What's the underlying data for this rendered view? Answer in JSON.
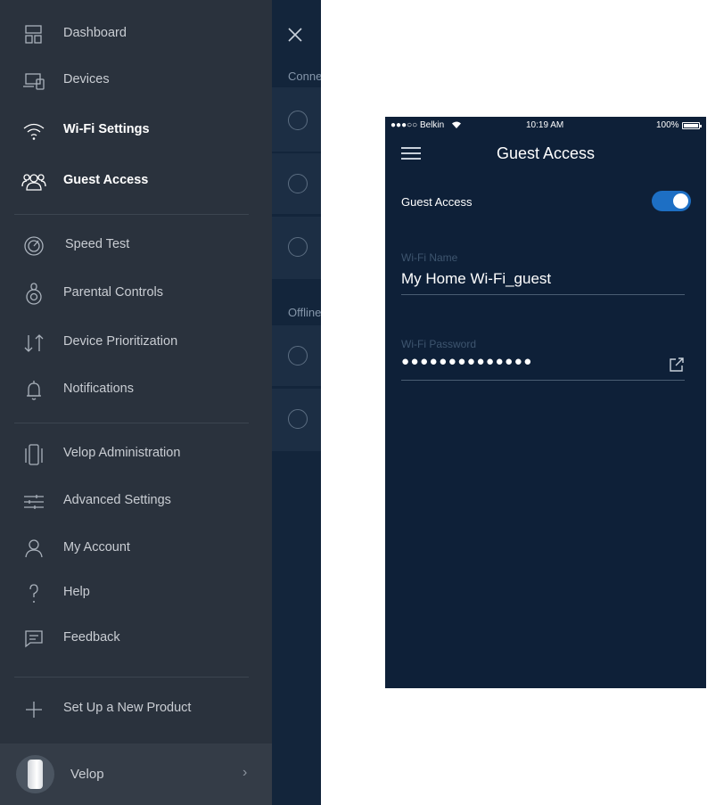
{
  "drawer": {
    "items": [
      {
        "label": "Dashboard",
        "icon": "dashboard-icon"
      },
      {
        "label": "Devices",
        "icon": "devices-icon"
      },
      {
        "label": "Wi-Fi Settings",
        "icon": "wifi-icon"
      },
      {
        "label": "Guest Access",
        "icon": "guest-access-icon"
      },
      {
        "label": "Speed Test",
        "icon": "speed-test-icon"
      },
      {
        "label": "Parental Controls",
        "icon": "parental-controls-icon"
      },
      {
        "label": "Device Prioritization",
        "icon": "device-prioritization-icon"
      },
      {
        "label": "Notifications",
        "icon": "bell-icon"
      },
      {
        "label": "Velop Administration",
        "icon": "velop-admin-icon"
      },
      {
        "label": "Advanced Settings",
        "icon": "sliders-icon"
      },
      {
        "label": "My Account",
        "icon": "account-icon"
      },
      {
        "label": "Help",
        "icon": "help-icon"
      },
      {
        "label": "Feedback",
        "icon": "feedback-icon"
      },
      {
        "label": "Set Up a New Product",
        "icon": "plus-icon"
      }
    ],
    "footer": {
      "label": "Velop"
    }
  },
  "background": {
    "connected_label": "Conne",
    "offline_label": "Offline"
  },
  "phone": {
    "status": {
      "carrier": "●●●○○ Belkin",
      "time": "10:19 AM",
      "battery": "100%"
    },
    "title": "Guest Access",
    "guest_access_label": "Guest Access",
    "guest_access_enabled": true,
    "wifi_name": {
      "label": "Wi-Fi Name",
      "value": "My Home Wi-Fi_guest"
    },
    "wifi_password": {
      "label": "Wi-Fi Password",
      "value": "●●●●●●●●●●●●●●"
    }
  },
  "colors": {
    "drawer_bg": "#2a323d",
    "phone_bg": "#0e2038",
    "toggle_on": "#1d6fc4"
  }
}
